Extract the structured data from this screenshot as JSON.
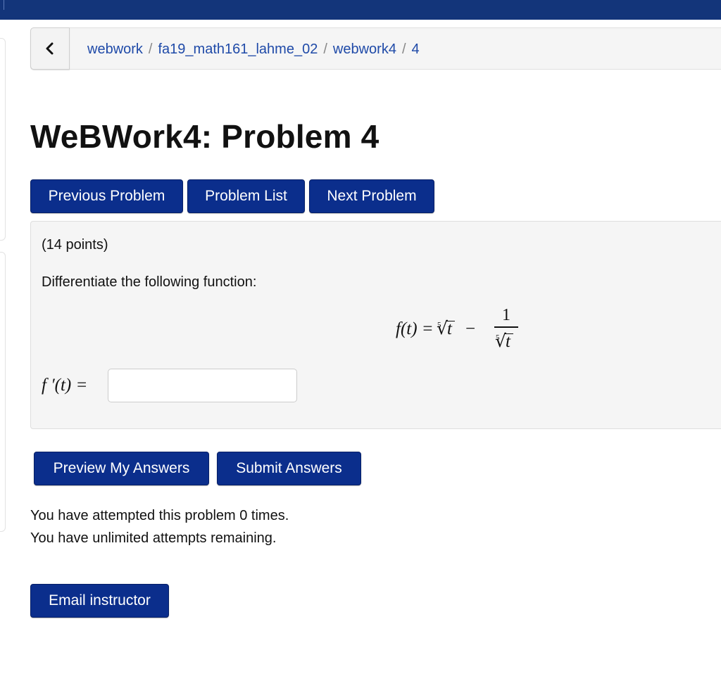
{
  "breadcrumb": {
    "items": [
      "webwork",
      "fa19_math161_lahme_02",
      "webwork4",
      "4"
    ],
    "separator": "/"
  },
  "page_title": "WeBWork4: Problem 4",
  "nav": {
    "previous": "Previous Problem",
    "list": "Problem List",
    "next": "Next Problem"
  },
  "problem": {
    "points": "(14 points)",
    "instruction": "Differentiate the following function:",
    "formula": {
      "lhs": "f(t) =",
      "root_index": "5",
      "radical": "√",
      "radicand": "t",
      "minus": "−",
      "numerator": "1"
    },
    "answer_label": "f ′(t) =",
    "answer_value": "",
    "answer_placeholder": ""
  },
  "actions": {
    "preview": "Preview My Answers",
    "submit": "Submit Answers"
  },
  "status": {
    "attempted": "You have attempted this problem 0 times.",
    "remaining": "You have unlimited attempts remaining."
  },
  "email": "Email instructor",
  "colors": {
    "topbar": "#13357a",
    "button": "#0b2e8c",
    "link": "#1f4aa8",
    "panel": "#f5f5f5"
  },
  "icons": {
    "back": "chevron-left-icon"
  }
}
